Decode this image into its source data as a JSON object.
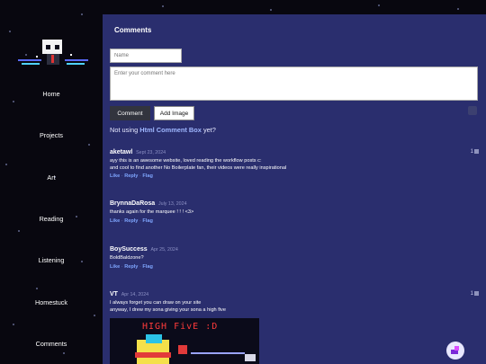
{
  "nav": [
    "Home",
    "Projects",
    "Art",
    "Reading",
    "Listening",
    "Homestuck",
    "Comments"
  ],
  "comments_section": {
    "title": "Comments",
    "name_placeholder": "Name",
    "comment_placeholder": "Enter your comment here",
    "comment_button": "Comment",
    "add_image_button": "Add Image",
    "notice_prefix": "Not using",
    "notice_link": "Html Comment Box",
    "notice_suffix": "yet?"
  },
  "comments": [
    {
      "user": "aketawl",
      "date": "Sept 23, 2024",
      "lines": [
        "ayy this is an awesome website, loved reading the workflow posts c:",
        "and cool to find another No Boilerplate fan, their videos were really inspirational"
      ],
      "likes": "1",
      "actions": [
        "Like",
        "Reply",
        "Flag"
      ]
    },
    {
      "user": "BrynnaDaRosa",
      "date": "July 13, 2024",
      "lines": [
        "thanks again for the marquee ! ! ! <3>"
      ],
      "likes": "",
      "actions": [
        "Like",
        "Reply",
        "Flag"
      ]
    },
    {
      "user": "BoySuccess",
      "date": "Apr 25, 2024",
      "lines": [
        "BoldBaldzone?"
      ],
      "likes": "",
      "actions": [
        "Like",
        "Reply",
        "Flag"
      ]
    },
    {
      "user": "VT",
      "date": "Apr 14, 2024",
      "lines": [
        "I always forget you can draw on your site",
        "anyway, I drew my sona giving your sona a high five"
      ],
      "likes": "1",
      "actions": []
    }
  ],
  "drawing": {
    "text": "HIGH FivE :D"
  },
  "colors": {
    "background": "#08070f",
    "panel": "#2a2e6e",
    "link": "#7fa6ff"
  }
}
